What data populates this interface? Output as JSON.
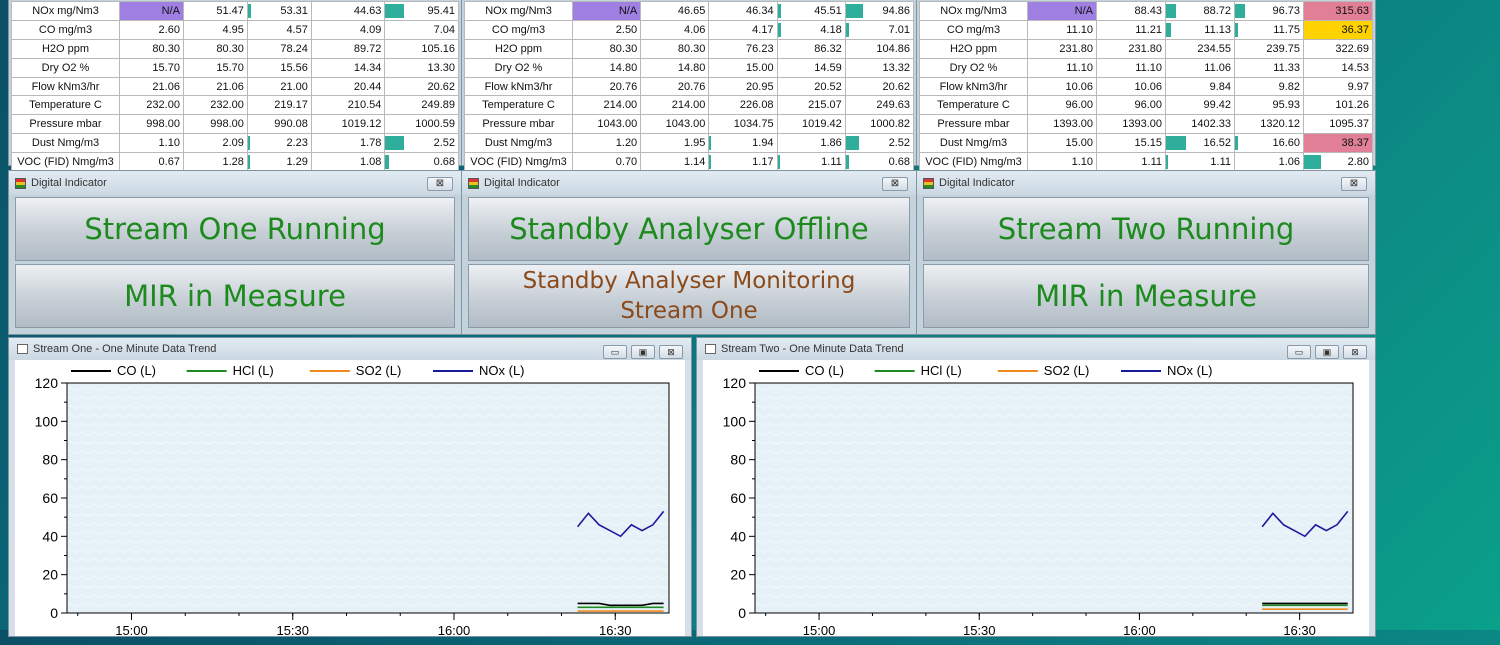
{
  "tables": [
    {
      "rows": [
        {
          "label": "NOx mg/Nm3",
          "values": [
            "N/A",
            "51.47",
            "53.31",
            "44.63",
            "95.41"
          ],
          "bg": [
            "purple",
            "",
            "",
            "",
            ""
          ],
          "bars": [
            0,
            0,
            0.05,
            0,
            0.25
          ]
        },
        {
          "label": "CO mg/m3",
          "values": [
            "2.60",
            "4.95",
            "4.57",
            "4.09",
            "7.04"
          ],
          "bg": [
            "",
            "",
            "",
            "",
            ""
          ],
          "bars": [
            0,
            0,
            0,
            0,
            0
          ]
        },
        {
          "label": "H2O ppm",
          "values": [
            "80.30",
            "80.30",
            "78.24",
            "89.72",
            "105.16"
          ],
          "bg": [
            "",
            "",
            "",
            "",
            ""
          ],
          "bars": [
            0,
            0,
            0,
            0,
            0
          ]
        },
        {
          "label": "Dry O2 %",
          "values": [
            "15.70",
            "15.70",
            "15.56",
            "14.34",
            "13.30"
          ],
          "bg": [
            "",
            "",
            "",
            "",
            ""
          ],
          "bars": [
            0,
            0,
            0,
            0,
            0
          ]
        },
        {
          "label": "Flow kNm3/hr",
          "values": [
            "21.06",
            "21.06",
            "21.00",
            "20.44",
            "20.62"
          ],
          "bg": [
            "",
            "",
            "",
            "",
            ""
          ],
          "bars": [
            0,
            0,
            0,
            0,
            0
          ]
        },
        {
          "label": "Temperature C",
          "values": [
            "232.00",
            "232.00",
            "219.17",
            "210.54",
            "249.89"
          ],
          "bg": [
            "",
            "",
            "",
            "",
            ""
          ],
          "bars": [
            0,
            0,
            0,
            0,
            0
          ]
        },
        {
          "label": "Pressure mbar",
          "values": [
            "998.00",
            "998.00",
            "990.08",
            "1019.12",
            "1000.59"
          ],
          "bg": [
            "",
            "",
            "",
            "",
            ""
          ],
          "bars": [
            0,
            0,
            0,
            0,
            0
          ]
        },
        {
          "label": "Dust Nmg/m3",
          "values": [
            "1.10",
            "2.09",
            "2.23",
            "1.78",
            "2.52"
          ],
          "bg": [
            "",
            "",
            "",
            "",
            ""
          ],
          "bars": [
            0,
            0,
            0.03,
            0,
            0.25
          ]
        },
        {
          "label": "VOC (FID) Nmg/m3",
          "values": [
            "0.67",
            "1.28",
            "1.29",
            "1.08",
            "0.68"
          ],
          "bg": [
            "",
            "",
            "",
            "",
            ""
          ],
          "bars": [
            0,
            0,
            0.03,
            0,
            0.05
          ]
        }
      ]
    },
    {
      "rows": [
        {
          "label": "NOx mg/Nm3",
          "values": [
            "N/A",
            "46.65",
            "46.34",
            "45.51",
            "94.86"
          ],
          "bg": [
            "purple",
            "",
            "",
            "",
            ""
          ],
          "bars": [
            0,
            0,
            0,
            0.05,
            0.25
          ]
        },
        {
          "label": "CO mg/m3",
          "values": [
            "2.50",
            "4.06",
            "4.17",
            "4.18",
            "7.01"
          ],
          "bg": [
            "",
            "",
            "",
            "",
            ""
          ],
          "bars": [
            0,
            0,
            0,
            0.05,
            0.05
          ]
        },
        {
          "label": "H2O ppm",
          "values": [
            "80.30",
            "80.30",
            "76.23",
            "86.32",
            "104.86"
          ],
          "bg": [
            "",
            "",
            "",
            "",
            ""
          ],
          "bars": [
            0,
            0,
            0,
            0,
            0
          ]
        },
        {
          "label": "Dry O2 %",
          "values": [
            "14.80",
            "14.80",
            "15.00",
            "14.59",
            "13.32"
          ],
          "bg": [
            "",
            "",
            "",
            "",
            ""
          ],
          "bars": [
            0,
            0,
            0,
            0,
            0
          ]
        },
        {
          "label": "Flow kNm3/hr",
          "values": [
            "20.76",
            "20.76",
            "20.95",
            "20.52",
            "20.62"
          ],
          "bg": [
            "",
            "",
            "",
            "",
            ""
          ],
          "bars": [
            0,
            0,
            0,
            0,
            0
          ]
        },
        {
          "label": "Temperature C",
          "values": [
            "214.00",
            "214.00",
            "226.08",
            "215.07",
            "249.63"
          ],
          "bg": [
            "",
            "",
            "",
            "",
            ""
          ],
          "bars": [
            0,
            0,
            0,
            0,
            0
          ]
        },
        {
          "label": "Pressure mbar",
          "values": [
            "1043.00",
            "1043.00",
            "1034.75",
            "1019.42",
            "1000.82"
          ],
          "bg": [
            "",
            "",
            "",
            "",
            ""
          ],
          "bars": [
            0,
            0,
            0,
            0,
            0
          ]
        },
        {
          "label": "Dust Nmg/m3",
          "values": [
            "1.20",
            "1.95",
            "1.94",
            "1.86",
            "2.52"
          ],
          "bg": [
            "",
            "",
            "",
            "",
            ""
          ],
          "bars": [
            0,
            0,
            0.03,
            0,
            0.2
          ]
        },
        {
          "label": "VOC (FID) Nmg/m3",
          "values": [
            "0.70",
            "1.14",
            "1.17",
            "1.11",
            "0.68"
          ],
          "bg": [
            "",
            "",
            "",
            "",
            ""
          ],
          "bars": [
            0,
            0,
            0.03,
            0.03,
            0.05
          ]
        }
      ]
    },
    {
      "rows": [
        {
          "label": "NOx mg/Nm3",
          "values": [
            "N/A",
            "88.43",
            "88.72",
            "96.73",
            "315.63"
          ],
          "bg": [
            "purple",
            "",
            "",
            "",
            "red"
          ],
          "bars": [
            0,
            0,
            0.15,
            0.15,
            0
          ]
        },
        {
          "label": "CO mg/m3",
          "values": [
            "11.10",
            "11.21",
            "11.13",
            "11.75",
            "36.37"
          ],
          "bg": [
            "",
            "",
            "",
            "",
            "yellow"
          ],
          "bars": [
            0,
            0,
            0.07,
            0.05,
            0
          ]
        },
        {
          "label": "H2O ppm",
          "values": [
            "231.80",
            "231.80",
            "234.55",
            "239.75",
            "322.69"
          ],
          "bg": [
            "",
            "",
            "",
            "",
            ""
          ],
          "bars": [
            0,
            0,
            0,
            0,
            0
          ]
        },
        {
          "label": "Dry O2 %",
          "values": [
            "11.10",
            "11.10",
            "11.06",
            "11.33",
            "14.53"
          ],
          "bg": [
            "",
            "",
            "",
            "",
            ""
          ],
          "bars": [
            0,
            0,
            0,
            0,
            0
          ]
        },
        {
          "label": "Flow kNm3/hr",
          "values": [
            "10.06",
            "10.06",
            "9.84",
            "9.82",
            "9.97"
          ],
          "bg": [
            "",
            "",
            "",
            "",
            ""
          ],
          "bars": [
            0,
            0,
            0,
            0,
            0
          ]
        },
        {
          "label": "Temperature C",
          "values": [
            "96.00",
            "96.00",
            "99.42",
            "95.93",
            "101.26"
          ],
          "bg": [
            "",
            "",
            "",
            "",
            ""
          ],
          "bars": [
            0,
            0,
            0,
            0,
            0
          ]
        },
        {
          "label": "Pressure mbar",
          "values": [
            "1393.00",
            "1393.00",
            "1402.33",
            "1320.12",
            "1095.37"
          ],
          "bg": [
            "",
            "",
            "",
            "",
            ""
          ],
          "bars": [
            0,
            0,
            0,
            0,
            0
          ]
        },
        {
          "label": "Dust Nmg/m3",
          "values": [
            "15.00",
            "15.15",
            "16.52",
            "16.60",
            "38.37"
          ],
          "bg": [
            "",
            "",
            "",
            "",
            "red"
          ],
          "bars": [
            0,
            0,
            0.3,
            0.05,
            0
          ]
        },
        {
          "label": "VOC (FID) Nmg/m3",
          "values": [
            "1.10",
            "1.11",
            "1.11",
            "1.06",
            "2.80"
          ],
          "bg": [
            "",
            "",
            "",
            "",
            ""
          ],
          "bars": [
            0,
            0,
            0.03,
            0,
            0.25
          ]
        }
      ]
    }
  ],
  "indicators": [
    {
      "title": "Digital Indicator",
      "close": "⊠",
      "line1": "Stream One Running",
      "line2": "MIR in Measure"
    },
    {
      "title": "Digital Indicator",
      "close": "⊠",
      "line1": "Standby Analyser Offline",
      "line2": "Standby Analyser Monitoring Stream One"
    },
    {
      "title": "Digital Indicator",
      "close": "⊠",
      "line1": "Stream Two Running",
      "line2": "MIR in Measure"
    }
  ],
  "colors": {
    "purple": "#9f7fe2",
    "red": "#e07f95",
    "yellow": "#ffd200",
    "bar": "#2fae9c",
    "ok_text": "#1d8a1d",
    "warn_text": "#8b4a1c"
  },
  "chart_data": [
    {
      "type": "line",
      "title": "Stream One - One Minute Data Trend",
      "ylim": [
        0,
        120
      ],
      "yticks": [
        0,
        20,
        40,
        60,
        80,
        100,
        120
      ],
      "xticks": [
        "15:00",
        "15:30",
        "16:00",
        "16:30"
      ],
      "series": [
        {
          "name": "CO (L)",
          "color": "#000000",
          "x": [
            "16:23",
            "16:25",
            "16:27",
            "16:29",
            "16:31",
            "16:33",
            "16:35",
            "16:37",
            "16:39"
          ],
          "y": [
            5,
            5,
            5,
            4,
            4,
            4,
            4,
            5,
            5
          ]
        },
        {
          "name": "HCl (L)",
          "color": "#1f8a1f",
          "x": [
            "16:23",
            "16:25",
            "16:27",
            "16:29",
            "16:31",
            "16:33",
            "16:35",
            "16:37",
            "16:39"
          ],
          "y": [
            3,
            3,
            3,
            3,
            3,
            3,
            3,
            3,
            3
          ]
        },
        {
          "name": "SO2 (L)",
          "color": "#f08a1e",
          "x": [
            "16:23",
            "16:25",
            "16:27",
            "16:29",
            "16:31",
            "16:33",
            "16:35",
            "16:37",
            "16:39"
          ],
          "y": [
            1,
            1,
            1,
            1,
            1,
            1,
            1,
            1,
            1
          ]
        },
        {
          "name": "NOx (L)",
          "color": "#1a1a9a",
          "x": [
            "16:23",
            "16:25",
            "16:27",
            "16:29",
            "16:31",
            "16:33",
            "16:35",
            "16:37",
            "16:39"
          ],
          "y": [
            45,
            52,
            46,
            43,
            40,
            46,
            43,
            46,
            53
          ]
        }
      ]
    },
    {
      "type": "line",
      "title": "Stream Two - One Minute Data Trend",
      "ylim": [
        0,
        120
      ],
      "yticks": [
        0,
        20,
        40,
        60,
        80,
        100,
        120
      ],
      "xticks": [
        "15:00",
        "15:30",
        "16:00",
        "16:30"
      ],
      "series": [
        {
          "name": "CO (L)",
          "color": "#000000",
          "x": [
            "16:23",
            "16:25",
            "16:27",
            "16:29",
            "16:31",
            "16:33",
            "16:35",
            "16:37",
            "16:39"
          ],
          "y": [
            5,
            5,
            5,
            5,
            5,
            5,
            5,
            5,
            5
          ]
        },
        {
          "name": "HCl (L)",
          "color": "#1f8a1f",
          "x": [
            "16:23",
            "16:25",
            "16:27",
            "16:29",
            "16:31",
            "16:33",
            "16:35",
            "16:37",
            "16:39"
          ],
          "y": [
            4,
            4,
            4,
            4,
            4,
            4,
            4,
            4,
            4
          ]
        },
        {
          "name": "SO2 (L)",
          "color": "#f08a1e",
          "x": [
            "16:23",
            "16:25",
            "16:27",
            "16:29",
            "16:31",
            "16:33",
            "16:35",
            "16:37",
            "16:39"
          ],
          "y": [
            2,
            2,
            2,
            2,
            2,
            2,
            2,
            2,
            2
          ]
        },
        {
          "name": "NOx (L)",
          "color": "#1a1a9a",
          "x": [
            "16:23",
            "16:25",
            "16:27",
            "16:29",
            "16:31",
            "16:33",
            "16:35",
            "16:37",
            "16:39"
          ],
          "y": [
            45,
            52,
            46,
            43,
            40,
            46,
            43,
            46,
            53
          ]
        }
      ]
    }
  ]
}
